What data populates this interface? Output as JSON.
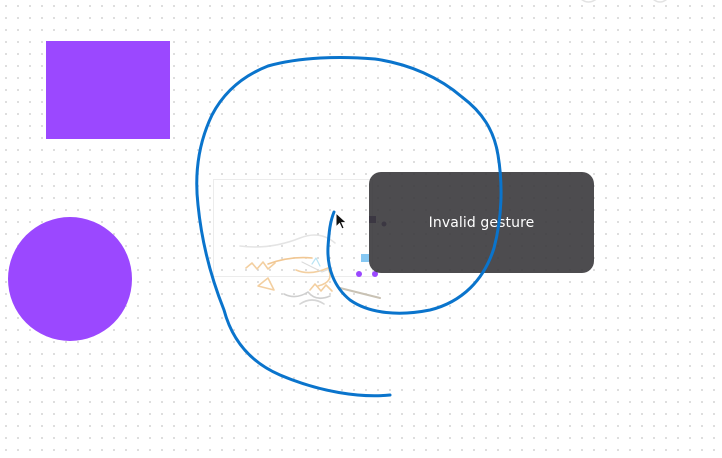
{
  "canvas": {
    "background": "#ffffff",
    "grid_dot_color": "#d3d3d3"
  },
  "shapes": {
    "square_color": "#9b48ff",
    "circle_color": "#9b48ff"
  },
  "gesture_stroke": {
    "color": "#0a74cc"
  },
  "toast": {
    "message": "Invalid gesture"
  },
  "cursor": {
    "icon": "arrow-pointer-icon"
  }
}
